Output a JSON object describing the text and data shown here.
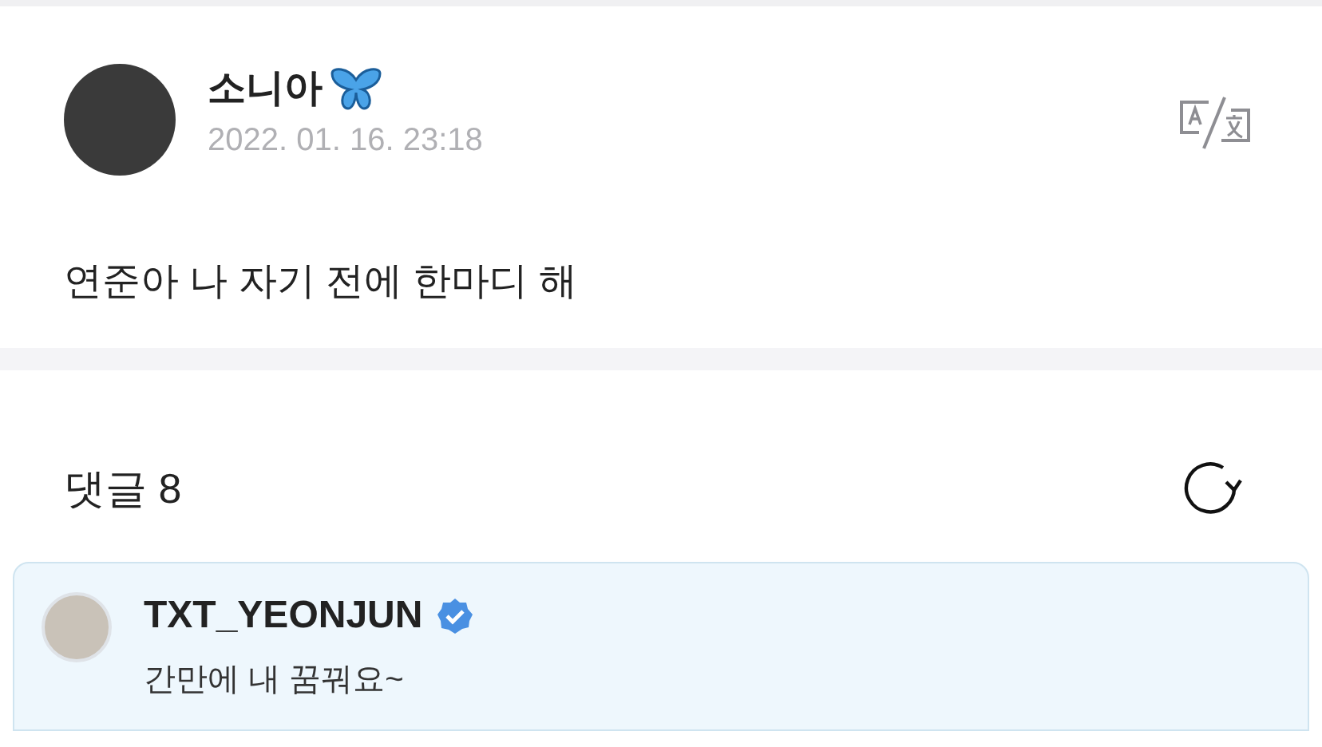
{
  "post": {
    "author": "소니아",
    "date": "2022. 01. 16. 23:18",
    "text": "연준아 나 자기 전에 한마디 해"
  },
  "comments_header": {
    "label": "댓글 8"
  },
  "comments": [
    {
      "author": "TXT_YEONJUN",
      "verified": true,
      "text": "간만에 내 꿈꿔요~"
    }
  ]
}
